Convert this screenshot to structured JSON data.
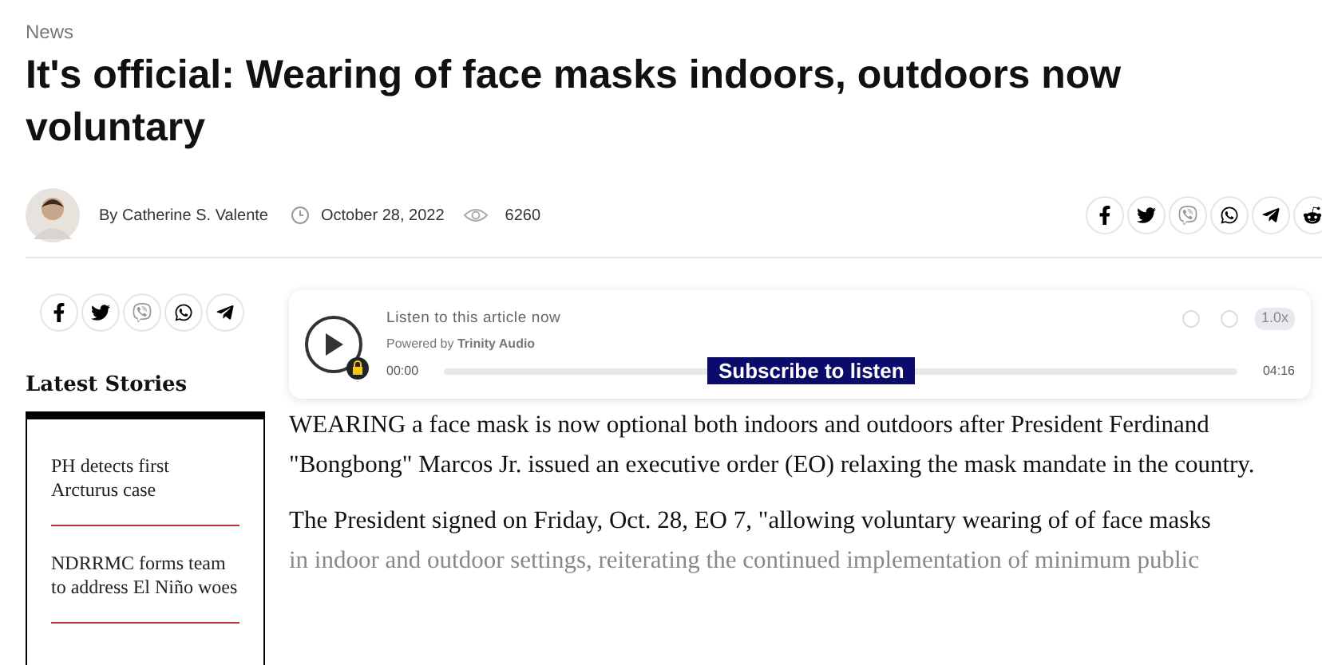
{
  "category": "News",
  "headline": "It's official: Wearing of face masks indoors, outdoors now voluntary",
  "byline": {
    "author": "By Catherine S. Valente",
    "date": "October 28, 2022",
    "views": "6260"
  },
  "sidebar": {
    "heading": "Latest Stories",
    "stories": [
      {
        "title": "PH detects first Arcturus case"
      },
      {
        "title": "NDRRMC forms team to address El Niño woes"
      }
    ]
  },
  "audio_player": {
    "title": "Listen to this article now",
    "powered_by": "Powered by **Trinity Audio**",
    "elapsed": "00:00",
    "duration": "04:16",
    "speed": "1.0x",
    "overlay": "Subscribe to listen"
  },
  "article": {
    "paragraphs": [
      {
        "text": "WEARING a face mask is now optional both indoors and outdoors after President Ferdinand \"Bongbong\" Marcos Jr. issued an executive order (EO) relaxing the mask mandate in the country.",
        "faded": false
      },
      {
        "text": "The President signed on Friday, Oct. 28, EO 7, \"allowing voluntary wearing of of face masks",
        "faded": false
      },
      {
        "text": "in indoor and outdoor settings, reiterating the continued implementation of minimum public",
        "faded": true
      }
    ]
  }
}
